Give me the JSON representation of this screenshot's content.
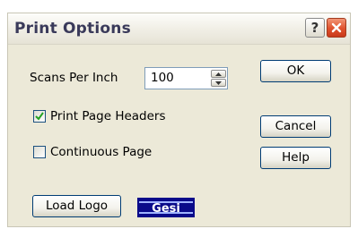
{
  "window": {
    "title": "Print Options",
    "help_glyph": "?",
    "help_icon": "question-icon",
    "close_icon": "close-icon"
  },
  "scans": {
    "label": "Scans Per Inch",
    "value": "100"
  },
  "checkboxes": [
    {
      "label": "Print Page Headers",
      "checked": true
    },
    {
      "label": "Continuous Page",
      "checked": false
    }
  ],
  "buttons": {
    "ok": "OK",
    "cancel": "Cancel",
    "help": "Help",
    "load_logo": "Load Logo"
  },
  "logo": {
    "text": "Gesi",
    "icon": "company-logo"
  },
  "colors": {
    "dialog_bg": "#ece9d8",
    "button_border": "#003c74",
    "close_button": "#e0512c",
    "checkmark": "#21a121",
    "logo_bg": "#0a0a8a"
  }
}
